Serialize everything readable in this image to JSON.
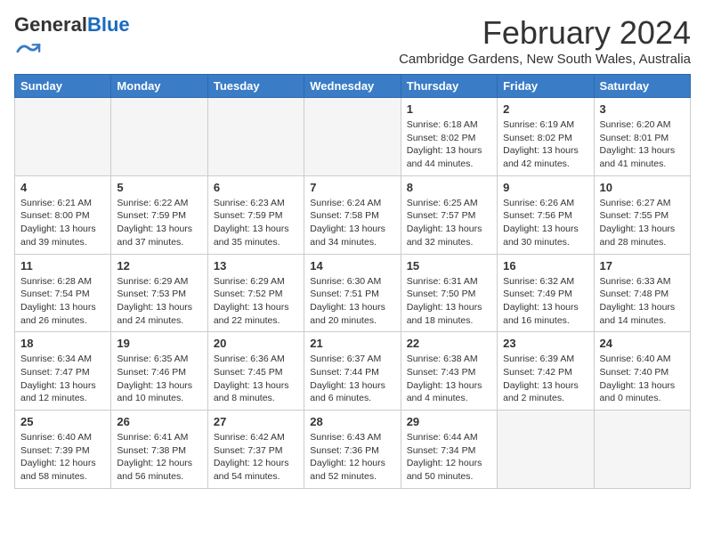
{
  "logo": {
    "general": "General",
    "blue": "Blue"
  },
  "title": "February 2024",
  "location": "Cambridge Gardens, New South Wales, Australia",
  "days_of_week": [
    "Sunday",
    "Monday",
    "Tuesday",
    "Wednesday",
    "Thursday",
    "Friday",
    "Saturday"
  ],
  "weeks": [
    [
      {
        "day": "",
        "info": ""
      },
      {
        "day": "",
        "info": ""
      },
      {
        "day": "",
        "info": ""
      },
      {
        "day": "",
        "info": ""
      },
      {
        "day": "1",
        "info": "Sunrise: 6:18 AM\nSunset: 8:02 PM\nDaylight: 13 hours and 44 minutes."
      },
      {
        "day": "2",
        "info": "Sunrise: 6:19 AM\nSunset: 8:02 PM\nDaylight: 13 hours and 42 minutes."
      },
      {
        "day": "3",
        "info": "Sunrise: 6:20 AM\nSunset: 8:01 PM\nDaylight: 13 hours and 41 minutes."
      }
    ],
    [
      {
        "day": "4",
        "info": "Sunrise: 6:21 AM\nSunset: 8:00 PM\nDaylight: 13 hours and 39 minutes."
      },
      {
        "day": "5",
        "info": "Sunrise: 6:22 AM\nSunset: 7:59 PM\nDaylight: 13 hours and 37 minutes."
      },
      {
        "day": "6",
        "info": "Sunrise: 6:23 AM\nSunset: 7:59 PM\nDaylight: 13 hours and 35 minutes."
      },
      {
        "day": "7",
        "info": "Sunrise: 6:24 AM\nSunset: 7:58 PM\nDaylight: 13 hours and 34 minutes."
      },
      {
        "day": "8",
        "info": "Sunrise: 6:25 AM\nSunset: 7:57 PM\nDaylight: 13 hours and 32 minutes."
      },
      {
        "day": "9",
        "info": "Sunrise: 6:26 AM\nSunset: 7:56 PM\nDaylight: 13 hours and 30 minutes."
      },
      {
        "day": "10",
        "info": "Sunrise: 6:27 AM\nSunset: 7:55 PM\nDaylight: 13 hours and 28 minutes."
      }
    ],
    [
      {
        "day": "11",
        "info": "Sunrise: 6:28 AM\nSunset: 7:54 PM\nDaylight: 13 hours and 26 minutes."
      },
      {
        "day": "12",
        "info": "Sunrise: 6:29 AM\nSunset: 7:53 PM\nDaylight: 13 hours and 24 minutes."
      },
      {
        "day": "13",
        "info": "Sunrise: 6:29 AM\nSunset: 7:52 PM\nDaylight: 13 hours and 22 minutes."
      },
      {
        "day": "14",
        "info": "Sunrise: 6:30 AM\nSunset: 7:51 PM\nDaylight: 13 hours and 20 minutes."
      },
      {
        "day": "15",
        "info": "Sunrise: 6:31 AM\nSunset: 7:50 PM\nDaylight: 13 hours and 18 minutes."
      },
      {
        "day": "16",
        "info": "Sunrise: 6:32 AM\nSunset: 7:49 PM\nDaylight: 13 hours and 16 minutes."
      },
      {
        "day": "17",
        "info": "Sunrise: 6:33 AM\nSunset: 7:48 PM\nDaylight: 13 hours and 14 minutes."
      }
    ],
    [
      {
        "day": "18",
        "info": "Sunrise: 6:34 AM\nSunset: 7:47 PM\nDaylight: 13 hours and 12 minutes."
      },
      {
        "day": "19",
        "info": "Sunrise: 6:35 AM\nSunset: 7:46 PM\nDaylight: 13 hours and 10 minutes."
      },
      {
        "day": "20",
        "info": "Sunrise: 6:36 AM\nSunset: 7:45 PM\nDaylight: 13 hours and 8 minutes."
      },
      {
        "day": "21",
        "info": "Sunrise: 6:37 AM\nSunset: 7:44 PM\nDaylight: 13 hours and 6 minutes."
      },
      {
        "day": "22",
        "info": "Sunrise: 6:38 AM\nSunset: 7:43 PM\nDaylight: 13 hours and 4 minutes."
      },
      {
        "day": "23",
        "info": "Sunrise: 6:39 AM\nSunset: 7:42 PM\nDaylight: 13 hours and 2 minutes."
      },
      {
        "day": "24",
        "info": "Sunrise: 6:40 AM\nSunset: 7:40 PM\nDaylight: 13 hours and 0 minutes."
      }
    ],
    [
      {
        "day": "25",
        "info": "Sunrise: 6:40 AM\nSunset: 7:39 PM\nDaylight: 12 hours and 58 minutes."
      },
      {
        "day": "26",
        "info": "Sunrise: 6:41 AM\nSunset: 7:38 PM\nDaylight: 12 hours and 56 minutes."
      },
      {
        "day": "27",
        "info": "Sunrise: 6:42 AM\nSunset: 7:37 PM\nDaylight: 12 hours and 54 minutes."
      },
      {
        "day": "28",
        "info": "Sunrise: 6:43 AM\nSunset: 7:36 PM\nDaylight: 12 hours and 52 minutes."
      },
      {
        "day": "29",
        "info": "Sunrise: 6:44 AM\nSunset: 7:34 PM\nDaylight: 12 hours and 50 minutes."
      },
      {
        "day": "",
        "info": ""
      },
      {
        "day": "",
        "info": ""
      }
    ]
  ]
}
